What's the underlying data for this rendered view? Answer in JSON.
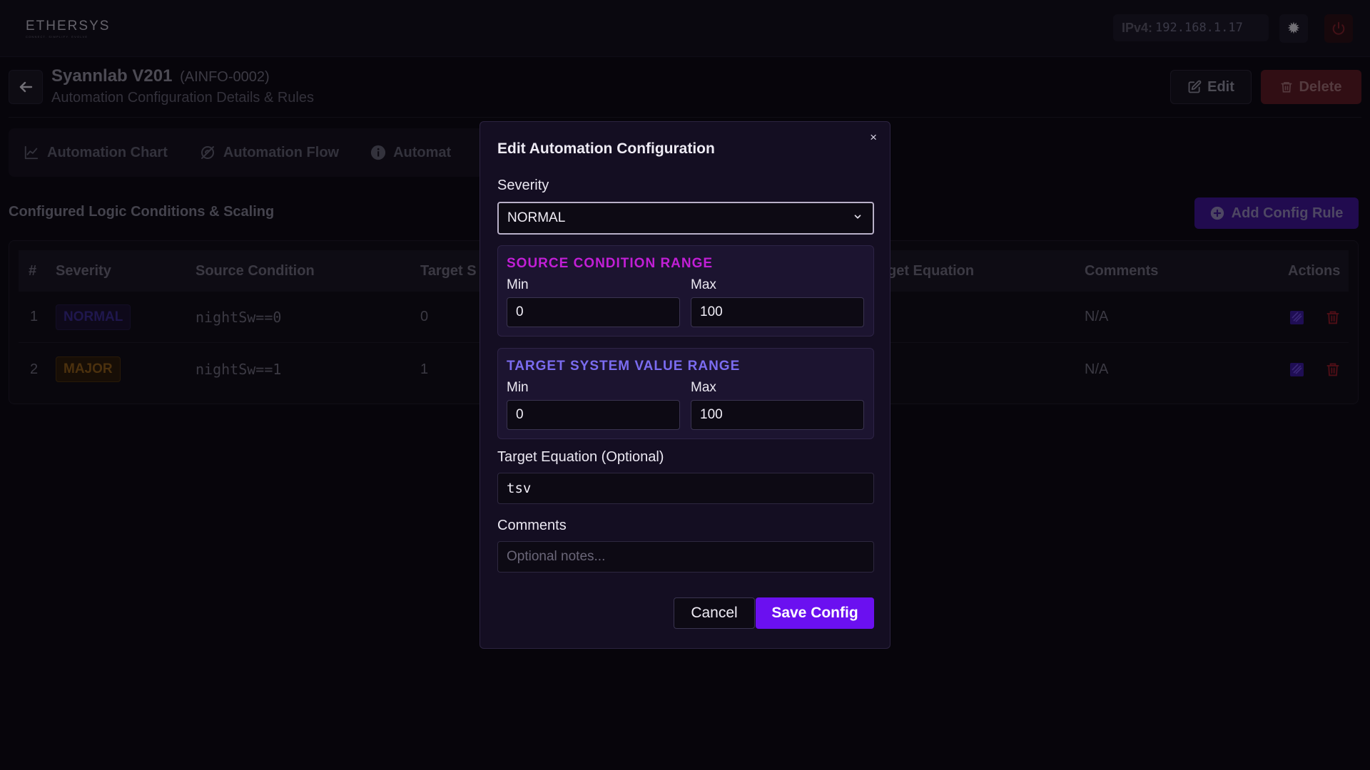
{
  "topbar": {
    "logo_text": "ETHERSYS",
    "logo_tagline": "CONNECT. SIMPLIFY. EVOLVE",
    "ip_label": "IPv4:",
    "ip_value": "192.168.1.17"
  },
  "header": {
    "title": "Syannlab V201",
    "code": "(AINFO-0002)",
    "subtitle": "Automation Configuration Details & Rules",
    "edit_label": "Edit",
    "delete_label": "Delete"
  },
  "tabs": [
    {
      "label": "Automation Chart",
      "icon": "line-chart-icon"
    },
    {
      "label": "Automation Flow",
      "icon": "flow-icon"
    },
    {
      "label": "Automat",
      "icon": "info-icon"
    }
  ],
  "section": {
    "title": "Configured Logic Conditions & Scaling",
    "add_rule_label": "Add Config Rule"
  },
  "table": {
    "headers": {
      "index": "#",
      "severity": "Severity",
      "source_condition": "Source Condition",
      "target": "Target S",
      "target_equation": "get Equation",
      "comments": "Comments",
      "actions": "Actions"
    },
    "rows": [
      {
        "index": "1",
        "severity": "NORMAL",
        "source_condition": "nightSw==0",
        "target": "0",
        "comments": "N/A"
      },
      {
        "index": "2",
        "severity": "MAJOR",
        "source_condition": "nightSw==1",
        "target": "1",
        "comments": "N/A"
      }
    ]
  },
  "modal": {
    "close": "×",
    "title": "Edit Automation Configuration",
    "severity_label": "Severity",
    "severity_value": "NORMAL",
    "source_range": {
      "title": "SOURCE CONDITION RANGE",
      "min_label": "Min",
      "max_label": "Max",
      "min_value": "0",
      "max_value": "100",
      "accent": "#c21fd6"
    },
    "target_range": {
      "title": "TARGET SYSTEM VALUE RANGE",
      "min_label": "Min",
      "max_label": "Max",
      "min_value": "0",
      "max_value": "100",
      "accent": "#7b6cf0"
    },
    "equation_label": "Target Equation (Optional)",
    "equation_value": "tsv",
    "comments_label": "Comments",
    "comments_placeholder": "Optional notes...",
    "cancel_label": "Cancel",
    "save_label": "Save Config"
  },
  "colors": {
    "primary": "#6b10f0",
    "danger": "#5a1a25",
    "background": "#0d0a14"
  }
}
